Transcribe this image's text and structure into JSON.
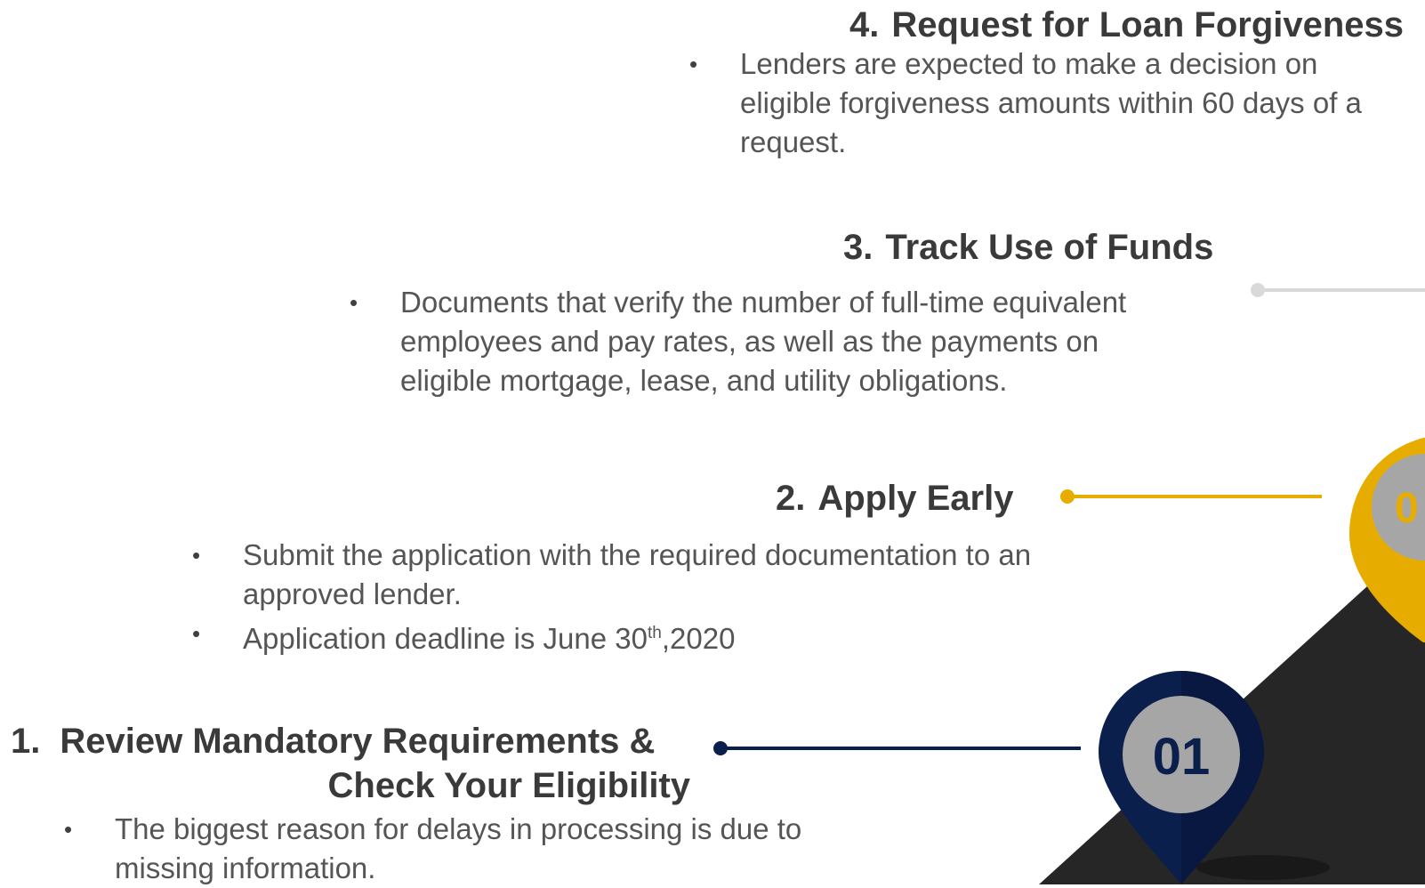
{
  "steps": [
    {
      "number": "1.",
      "title_line1": "Review Mandatory Requirements &",
      "title_line2": "Check Your Eligibility",
      "bullets": [
        "The biggest reason for delays in processing is due to missing information."
      ],
      "pin_label": "01",
      "color": "#0b1f4d"
    },
    {
      "number": "2.",
      "title": "Apply Early",
      "bullets": [
        "Submit the application with the required documentation to an approved lender.",
        {
          "prefix": "Application deadline is June 30",
          "sup": "th",
          "suffix": ",2020"
        }
      ],
      "pin_label": "0",
      "color": "#e6ac00"
    },
    {
      "number": "3.",
      "title": "Track Use of Funds",
      "bullets": [
        "Documents that verify the number of full-time equivalent employees and pay rates, as well as the payments on eligible mortgage, lease, and utility obligations."
      ],
      "color": "#d9d9d9"
    },
    {
      "number": "4.",
      "title": "Request for Loan Forgiveness",
      "bullets": [
        "Lenders are expected to make a decision on eligible forgiveness amounts within 60 days of a request."
      ]
    }
  ],
  "bullet_symbol": "•",
  "colors": {
    "mountain": "#262626",
    "pin_inner": "#a6a6a6"
  }
}
